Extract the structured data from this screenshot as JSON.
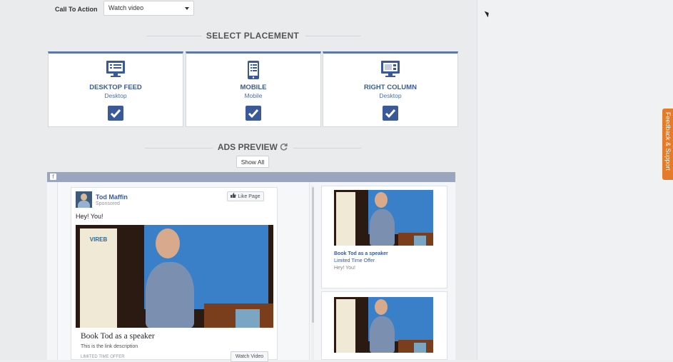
{
  "call_to_action": {
    "label": "Call To Action",
    "value": "Watch video"
  },
  "select_placement": {
    "title": "SELECT PLACEMENT",
    "cards": [
      {
        "title": "DESKTOP FEED",
        "sub": "Desktop",
        "icon": "desktop-feed-icon",
        "checked": true
      },
      {
        "title": "MOBILE",
        "sub": "Mobile",
        "icon": "mobile-icon",
        "checked": true
      },
      {
        "title": "RIGHT COLUMN",
        "sub": "Desktop",
        "icon": "right-column-icon",
        "checked": true
      }
    ]
  },
  "ads_preview": {
    "title": "ADS PREVIEW",
    "refresh_icon": "refresh-icon",
    "show_all": "Show All"
  },
  "fb_icon": "f",
  "post": {
    "name": "Tod Maffin",
    "sponsored": "Sponsored",
    "like_page": "Like Page",
    "text": "Hey! You!",
    "link_title": "Book Tod as a speaker",
    "link_description": "This is the link description",
    "link_caption": "LIMITED TIME OFFER",
    "cta": "Watch Video",
    "banner_text": "VIREB"
  },
  "right_column_ad": {
    "title": "Book Tod as a speaker",
    "subtitle": "Limited Time Offer",
    "text": "Hey! You!"
  },
  "feedback": "Feedback & Support",
  "colors": {
    "brand": "#3b5998",
    "accent": "#5b76a9",
    "feedback": "#e37b2b"
  }
}
